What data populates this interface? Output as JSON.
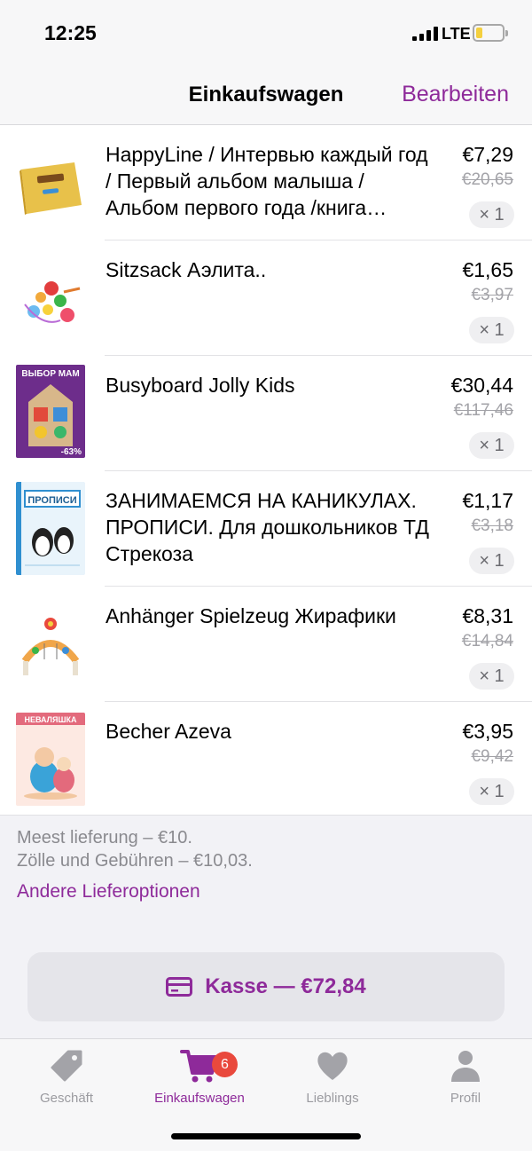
{
  "status_bar": {
    "time": "12:25",
    "network": "LTE"
  },
  "nav": {
    "title": "Einkaufswagen",
    "edit_label": "Bearbeiten"
  },
  "cart_items": [
    {
      "title": "HappyLine / Интервью каждый год / Первый альбом малыша / Альбом первого года /книга…",
      "price": "€7,29",
      "old_price": "€20,65",
      "quantity": "× 1"
    },
    {
      "title": "Sitzsack Аэлита..",
      "price": "€1,65",
      "old_price": "€3,97",
      "quantity": "× 1"
    },
    {
      "title": "Busyboard Jolly Kids",
      "price": "€30,44",
      "old_price": "€117,46",
      "quantity": "× 1",
      "thumb_text": "ВЫБОР МАМ",
      "thumb_badge": "-63%"
    },
    {
      "title": "ЗАНИМАЕМСЯ НА КАНИКУЛАХ. ПРОПИСИ. Для дошкольников ТД Стрекоза",
      "price": "€1,17",
      "old_price": "€3,18",
      "quantity": "× 1",
      "thumb_text": "ПРОПИСИ"
    },
    {
      "title": "Anhänger Spielzeug Жирафики",
      "price": "€8,31",
      "old_price": "€14,84",
      "quantity": "× 1"
    },
    {
      "title": "Becher Azeva",
      "price": "€3,95",
      "old_price": "€9,42",
      "quantity": "× 1",
      "thumb_text": "НЕВАЛЯШКА"
    }
  ],
  "summary": {
    "delivery": "Meest lieferung – €10.",
    "fees": "Zölle und Gebühren – €10,03.",
    "options_link": "Andere Lieferoptionen",
    "checkout_label": "Kasse — €72,84"
  },
  "tabs": [
    {
      "label": "Geschäft",
      "icon": "tag-icon"
    },
    {
      "label": "Einkaufswagen",
      "icon": "cart-icon",
      "badge": "6",
      "active": true
    },
    {
      "label": "Lieblings",
      "icon": "heart-icon"
    },
    {
      "label": "Profil",
      "icon": "person-icon"
    }
  ],
  "colors": {
    "accent": "#8e2a9a",
    "badge": "#e9493d"
  }
}
